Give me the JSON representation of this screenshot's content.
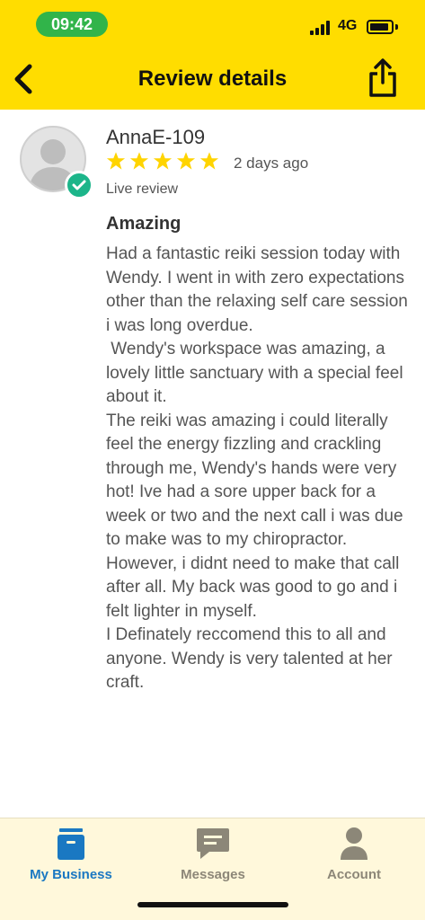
{
  "status_bar": {
    "time": "09:42",
    "network": "4G",
    "time_pill_color": "#31B44A"
  },
  "header": {
    "title": "Review details",
    "background_color": "#FFDD00"
  },
  "review": {
    "reviewer_name": "AnnaE-109",
    "rating": 5,
    "max_rating": 5,
    "age": "2 days ago",
    "type": "Live review",
    "title": "Amazing",
    "body": "Had a fantastic reiki session today with Wendy. I went in with zero expectations other than the relaxing self care session i was long overdue.\n Wendy's workspace was amazing, a lovely little sanctuary with a special feel about it.\nThe reiki was amazing i could literally feel the energy fizzling and crackling through me, Wendy's hands were very hot! Ive had a sore upper back for a week or two and the next call i was due to make was to my chiropractor. However, i didnt need to make that call after all. My back was good to go and i felt lighter in myself.\nI Definately reccomend this to all and anyone. Wendy is very talented at her craft.",
    "star_color": "#FFD400",
    "verified_color": "#1CB58A"
  },
  "tab_bar": {
    "tabs": [
      {
        "label": "My Business",
        "icon": "briefcase-icon",
        "active": true
      },
      {
        "label": "Messages",
        "icon": "chat-bubble-icon",
        "active": false
      },
      {
        "label": "Account",
        "icon": "person-icon",
        "active": false
      }
    ],
    "active_color": "#1A78C2",
    "inactive_color": "#8C8778"
  }
}
